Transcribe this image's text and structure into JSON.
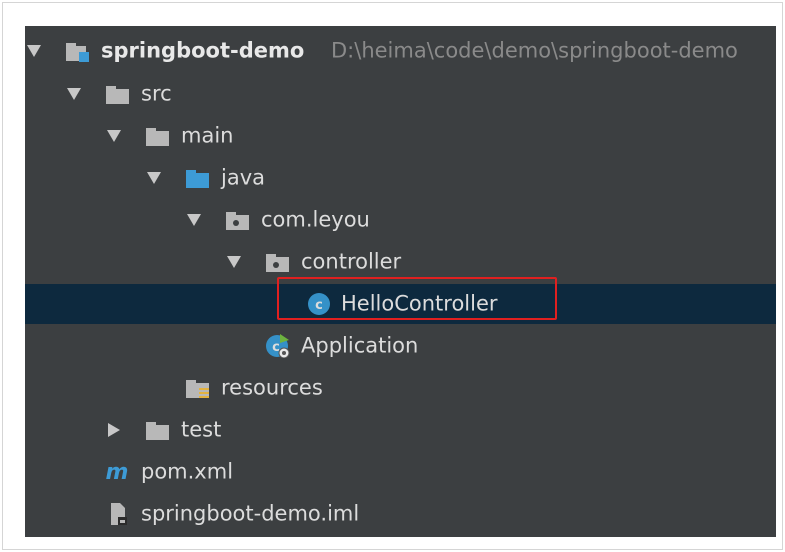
{
  "project_tree": {
    "root": {
      "name": "springboot-demo",
      "path": "D:\\heima\\code\\demo\\springboot-demo"
    },
    "items": [
      {
        "label": "src"
      },
      {
        "label": "main"
      },
      {
        "label": "java"
      },
      {
        "label": "com.leyou"
      },
      {
        "label": "controller"
      },
      {
        "label": "HelloController",
        "selected": true
      },
      {
        "label": "Application"
      },
      {
        "label": "resources"
      },
      {
        "label": "test"
      },
      {
        "label": "pom.xml"
      },
      {
        "label": "springboot-demo.iml"
      }
    ]
  },
  "colors": {
    "panel_background": "#3c3f41",
    "selection_background": "#0d293e",
    "highlight_border": "#e02020",
    "folder_gray": "#b8b8b8",
    "source_folder_blue": "#3d9bd6",
    "class_icon_blue": "#3591c8"
  },
  "icons": {
    "module": "module-folder-icon",
    "folder": "folder-icon",
    "source_folder": "source-folder-icon",
    "package": "package-icon",
    "class": "class-icon",
    "spring_app": "spring-boot-class-icon",
    "resources": "resources-folder-icon",
    "maven": "maven-icon",
    "module_file": "iml-file-icon"
  }
}
